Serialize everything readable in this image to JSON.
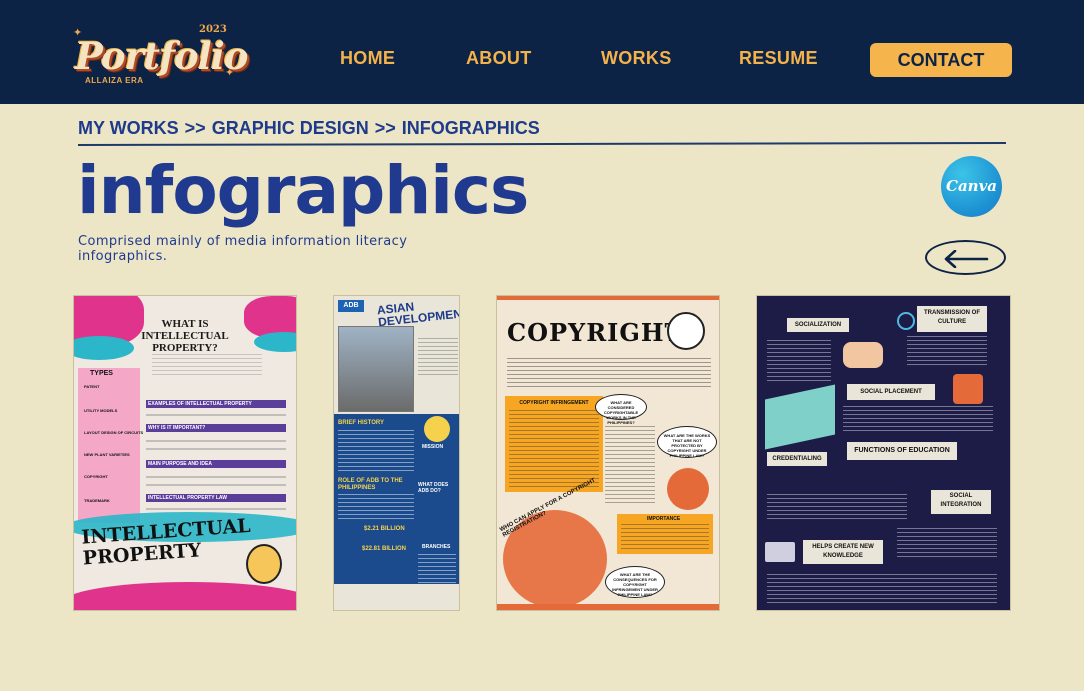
{
  "nav": {
    "logo": {
      "word": "Portfolio",
      "year": "2023",
      "subtitle": "ALLAIZA ERA"
    },
    "links": [
      "HOME",
      "ABOUT",
      "WORKS",
      "RESUME"
    ],
    "contact": "CONTACT"
  },
  "breadcrumb": [
    "MY WORKS",
    ">>",
    "GRAPHIC DESIGN",
    ">>",
    "INFOGRAPHICS"
  ],
  "page": {
    "title": "infographics",
    "description": "Comprised mainly of media information literacy infographics.",
    "tool_badge": "Canva"
  },
  "gallery": [
    {
      "heading": "WHAT IS INTELLECTUAL PROPERTY?",
      "sections": [
        "TYPES",
        "EXAMPLES OF INTELLECTUAL PROPERTY",
        "WHY IS IT IMPORTANT?",
        "MAIN PURPOSE AND IDEA",
        "INTELLECTUAL PROPERTY LAW"
      ],
      "types": [
        "PATENT",
        "UTILITY MODELS",
        "LAYOUT DESIGN OF CIRCUITS",
        "NEW PLANT VARIETIES",
        "COPYRIGHT",
        "TRADEMARK"
      ],
      "footer": "INTELLECTUAL PROPERTY"
    },
    {
      "logo": "ADB",
      "heading": "ASIAN DEVELOPMENT BANK",
      "sections": [
        "BRIEF HISTORY",
        "MISSION",
        "ROLE OF ADB TO THE PHILIPPINES",
        "WHAT DOES ADB DO?",
        "BRANCHES"
      ],
      "stats": [
        "$2.21 BILLION",
        "$22.81 BILLION"
      ]
    },
    {
      "heading": "COPYRIGHT",
      "sections": [
        "COPYRIGHT INFRINGEMENT",
        "WHAT ARE CONSIDERED COPYRIGHTABLE WORKS IN THE PHILIPPINES?",
        "WHAT ARE THE WORKS THAT ARE NOT PROTECTED BY COPYRIGHT UNDER PHILIPPINE LAW?",
        "IMPORTANCE",
        "WHAT ARE THE CONSEQUENCES FOR COPYRIGHT INFRINGEMENT UNDER PHILIPPINE LAW?"
      ],
      "arc": "WHO CAN APPLY FOR A COPYRIGHT REGISTRATION?"
    },
    {
      "sections": [
        "SOCIALIZATION",
        "TRANSMISSION OF CULTURE",
        "SOCIAL PLACEMENT",
        "FUNCTIONS OF EDUCATION",
        "CREDENTIALING",
        "SOCIAL INTEGRATION",
        "HELPS CREATE NEW KNOWLEDGE"
      ]
    }
  ],
  "colors": {
    "navy": "#0C2346",
    "cream": "#EDE6C6",
    "accent": "#F6B54C",
    "title_blue": "#1F3A8F"
  },
  "icons": {
    "back": "arrow-left-icon",
    "sparkle": "sparkle-icon"
  }
}
